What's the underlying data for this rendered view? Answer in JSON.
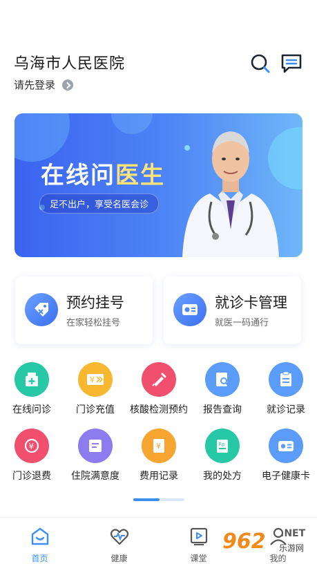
{
  "header": {
    "hospital_name": "乌海市人民医院",
    "login_text": "请先登录"
  },
  "banner": {
    "title_part1": "在线问",
    "title_part2": "医生",
    "subtitle": "足不出户，享受名医会诊"
  },
  "cards": [
    {
      "title": "预约挂号",
      "subtitle": "在家轻松挂号"
    },
    {
      "title": "就诊卡管理",
      "subtitle": "就医一码通行"
    }
  ],
  "grid": [
    {
      "label": "在线问诊",
      "icon": "medicine-box-icon",
      "color": "#27c8a6"
    },
    {
      "label": "门诊充值",
      "icon": "recharge-card-icon",
      "color": "#f7b731"
    },
    {
      "label": "核酸检测预约",
      "icon": "syringe-icon",
      "color": "#f0506e"
    },
    {
      "label": "报告查询",
      "icon": "report-search-icon",
      "color": "#5a9cf8"
    },
    {
      "label": "就诊记录",
      "icon": "clipboard-icon",
      "color": "#5a9cf8"
    },
    {
      "label": "门诊退费",
      "icon": "refund-icon",
      "color": "#f0506e"
    },
    {
      "label": "住院满意度",
      "icon": "survey-icon",
      "color": "#8c7cf0"
    },
    {
      "label": "费用记录",
      "icon": "fee-scroll-icon",
      "color": "#f7a531"
    },
    {
      "label": "我的处方",
      "icon": "prescription-icon",
      "color": "#27c8a6"
    },
    {
      "label": "电子健康卡",
      "icon": "health-card-icon",
      "color": "#5a9cf8"
    }
  ],
  "tabs": [
    {
      "label": "首页",
      "icon": "home-smile-icon",
      "active": true
    },
    {
      "label": "健康",
      "icon": "heartbeat-icon",
      "active": false
    },
    {
      "label": "课堂",
      "icon": "video-class-icon",
      "active": false
    },
    {
      "label": "我的",
      "icon": "profile-icon",
      "active": false
    }
  ],
  "watermark": {
    "num": "962",
    "net": ".NET",
    "cn": "乐游网"
  },
  "colors": {
    "accent": "#3a8ff0",
    "banner_start": "#3a63f0",
    "banner_end": "#6fb7f8"
  }
}
